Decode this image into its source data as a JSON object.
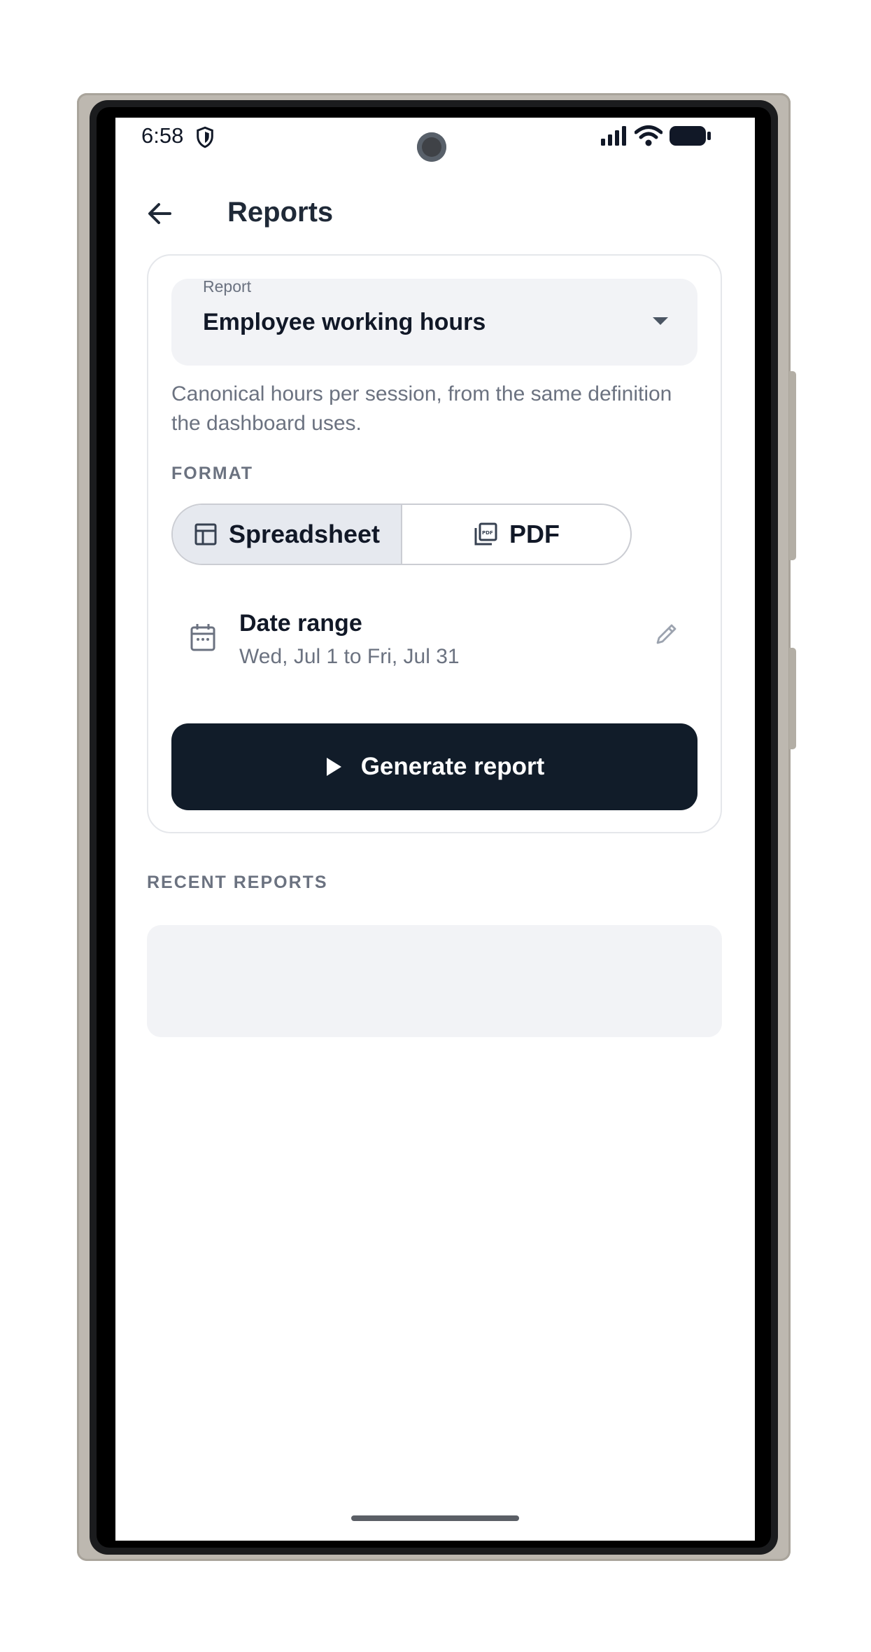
{
  "status_bar": {
    "time": "6:58"
  },
  "app_bar": {
    "title": "Reports"
  },
  "report_select": {
    "label": "Report",
    "value": "Employee working hours"
  },
  "report_description": "Canonical hours per session, from the same definition the dashboard uses.",
  "format": {
    "label": "FORMAT",
    "options": [
      {
        "label": "Spreadsheet",
        "selected": true,
        "icon": "table-icon"
      },
      {
        "label": "PDF",
        "selected": false,
        "icon": "pdf-icon"
      }
    ]
  },
  "date_range": {
    "title": "Date range",
    "value": "Wed, Jul 1 to Fri, Jul 31"
  },
  "generate_button": {
    "label": "Generate report",
    "icon": "play-icon"
  },
  "recent_reports": {
    "label": "RECENT REPORTS",
    "items": []
  },
  "colors": {
    "primary_button": "#111c29",
    "surface": "#f2f3f6",
    "selected_segment": "#e6e9ef"
  }
}
